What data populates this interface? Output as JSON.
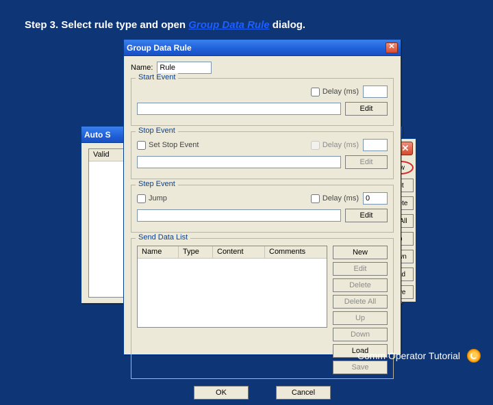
{
  "step": {
    "prefix": "Step 3. Select rule type and open ",
    "em": "Group Data Rule",
    "suffix": " dialog."
  },
  "footer": "Comm Operator Tutorial",
  "back_window": {
    "title": "Auto S",
    "list_header": "Valid"
  },
  "right_stack": {
    "new": "New",
    "edit": "Edit",
    "delete": "Delete",
    "delete_all": "ate All",
    "up": "Up",
    "down": "Down",
    "load": "Load",
    "save": "Save"
  },
  "dialog": {
    "title": "Group Data Rule",
    "name_label": "Name:",
    "name_value": "Rule",
    "start": {
      "label": "Start Event",
      "delay": "Delay (ms)",
      "delay_value": "",
      "edit": "Edit",
      "field": ""
    },
    "stopg": {
      "label": "Stop Event",
      "set": "Set Stop Event",
      "delay": "Delay (ms)",
      "delay_value": "",
      "edit": "Edit",
      "field": ""
    },
    "step": {
      "label": "Step Event",
      "jump": "Jump",
      "delay": "Delay (ms)",
      "delay_value": "0",
      "edit": "Edit",
      "field": ""
    },
    "list": {
      "label": "Send Data List",
      "h1": "Name",
      "h2": "Type",
      "h3": "Content",
      "h4": "Comments",
      "btns": {
        "new": "New",
        "edit": "Edit",
        "delete": "Delete",
        "delete_all": "Delete All",
        "up": "Up",
        "down": "Down",
        "load": "Load",
        "save": "Save"
      }
    },
    "ok": "OK",
    "cancel": "Cancel"
  }
}
